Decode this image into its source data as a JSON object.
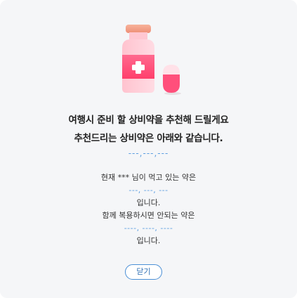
{
  "dialog": {
    "headline_line1": "여행시 준비 할 상비약을 추천해 드릴게요",
    "headline_line2": "추천드리는 상비약은 아래와 같습니다.",
    "recommended_placeholder": "---,---,---",
    "current_meds_line": "현재 *** 님이 먹고 있는 약은",
    "current_meds_placeholder": "---, ---, ---",
    "current_meds_suffix": "입니다.",
    "contra_line": "함께 복용하시면 안되는 약은",
    "contra_placeholder": "----, ----, ----",
    "contra_suffix": "입니다.",
    "close_label": "닫기"
  },
  "colors": {
    "bottle_cap": "#f4a48a",
    "bottle_body": "#ffd0d9",
    "bottle_label": "#ff4f7b",
    "pill_top": "#ffe3ea",
    "pill_bottom": "#ff4f7b",
    "placeholder_blue": "#5a9de0",
    "button_border": "#4a8fd6"
  },
  "icons": {
    "illustration": "medicine-bottle-icon",
    "pill": "capsule-icon"
  }
}
